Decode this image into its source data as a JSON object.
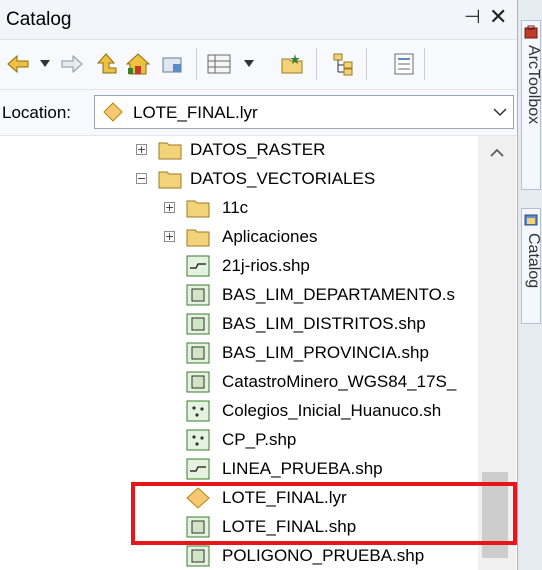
{
  "window": {
    "title": "Catalog",
    "pin_glyph": "⊣",
    "close_glyph": "✕"
  },
  "toolbar": {
    "icons": [
      "back-arrow-icon",
      "forward-arrow-icon",
      "up-one-level-icon",
      "home-icon",
      "connect-folder-icon",
      "view-icon",
      "new-folder-icon",
      "tree-icon",
      "details-icon"
    ]
  },
  "location": {
    "label": "Location:",
    "value": "LOTE_FINAL.lyr"
  },
  "tree": {
    "items": [
      {
        "label": "DATOS_RASTER",
        "expander": "+"
      },
      {
        "label": "DATOS_VECTORIALES",
        "expander": "−"
      },
      {
        "label": "11c",
        "expander": "+"
      },
      {
        "label": "Aplicaciones",
        "expander": "+"
      },
      {
        "label": "21j-rios.shp"
      },
      {
        "label": "BAS_LIM_DEPARTAMENTO.s"
      },
      {
        "label": "BAS_LIM_DISTRITOS.shp"
      },
      {
        "label": "BAS_LIM_PROVINCIA.shp"
      },
      {
        "label": "CatastroMinero_WGS84_17S_"
      },
      {
        "label": "Colegios_Inicial_Huanuco.sh"
      },
      {
        "label": "CP_P.shp"
      },
      {
        "label": "LINEA_PRUEBA.shp"
      },
      {
        "label": "LOTE_FINAL.lyr"
      },
      {
        "label": "LOTE_FINAL.shp"
      },
      {
        "label": "POLIGONO_PRUEBA.shp"
      }
    ]
  },
  "side_tabs": [
    {
      "label": "ArcToolbox"
    },
    {
      "label": "Catalog"
    }
  ],
  "colors": {
    "highlight": "#e8161b",
    "folder": "#f2d37a",
    "layer_diamond": "#f7c873",
    "shapefile": "#3a7d2c"
  }
}
